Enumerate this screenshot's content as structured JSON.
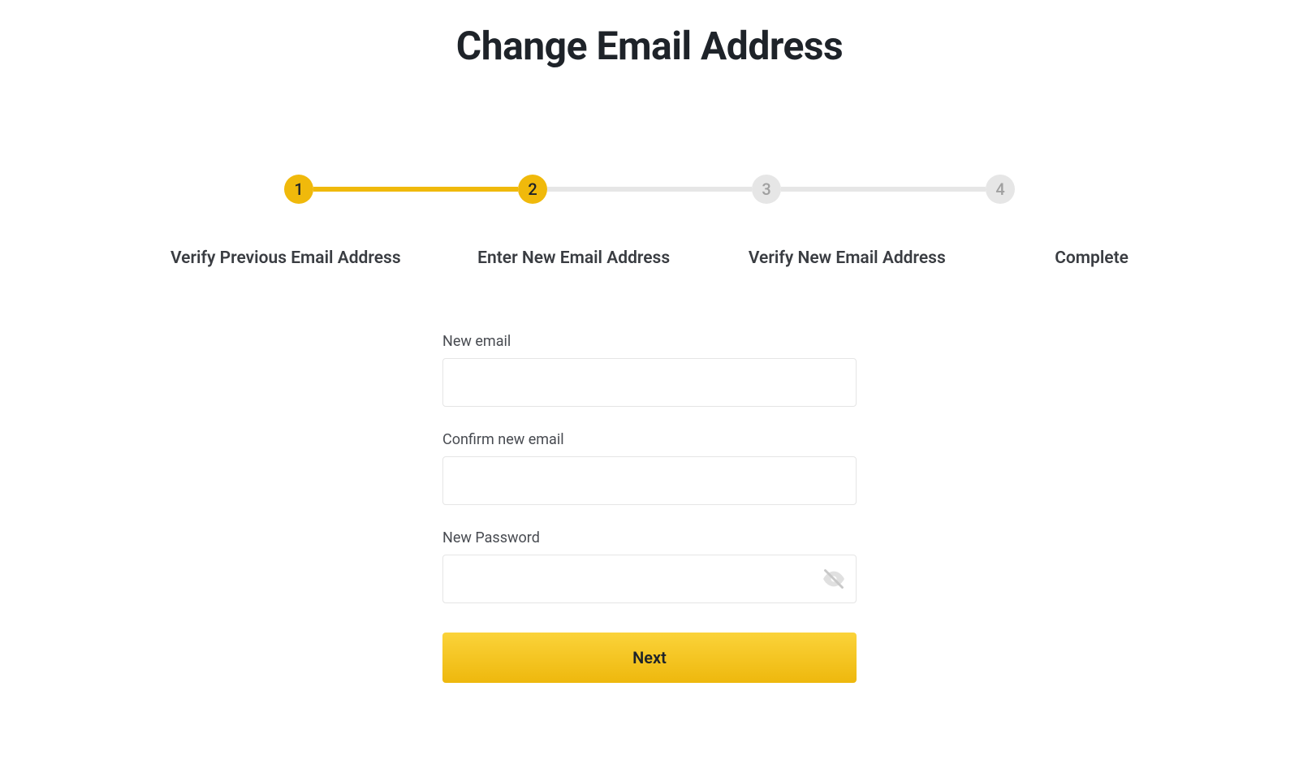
{
  "page_title": "Change Email Address",
  "stepper": {
    "steps": [
      {
        "num": "1",
        "label": "Verify Previous Email Address",
        "state": "active"
      },
      {
        "num": "2",
        "label": "Enter New Email Address",
        "state": "active"
      },
      {
        "num": "3",
        "label": "Verify New Email Address",
        "state": "inactive"
      },
      {
        "num": "4",
        "label": "Complete",
        "state": "inactive"
      }
    ]
  },
  "form": {
    "new_email": {
      "label": "New email",
      "value": ""
    },
    "confirm_email": {
      "label": "Confirm new email",
      "value": ""
    },
    "new_password": {
      "label": "New Password",
      "value": ""
    },
    "next_button": "Next"
  },
  "colors": {
    "accent": "#f0b90b",
    "text": "#1e2329",
    "muted_bg": "#e6e6e6",
    "muted_text": "#a0a0a0"
  }
}
